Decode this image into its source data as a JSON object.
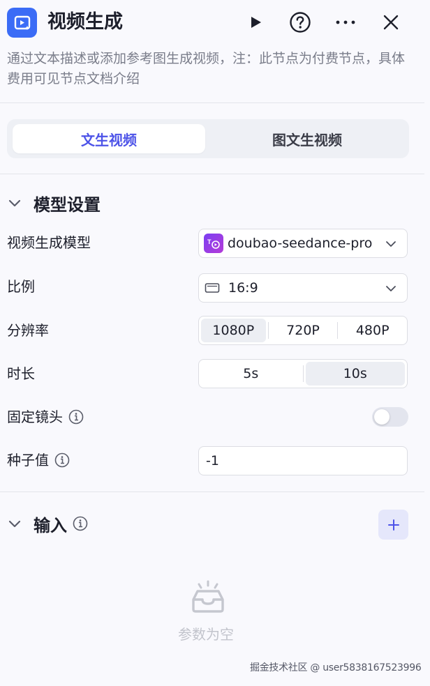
{
  "header": {
    "title": "视频生成",
    "run_icon": "play-icon",
    "help_icon": "question-circle-icon",
    "more_icon": "more-horizontal-icon",
    "close_icon": "close-icon"
  },
  "description": "通过文本描述或添加参考图生成视频，注：此节点为付费节点，具体费用可见节点文档介绍",
  "tabs": [
    {
      "label": "文生视频",
      "active": true
    },
    {
      "label": "图文生视频",
      "active": false
    }
  ],
  "model_section": {
    "title": "模型设置",
    "fields": {
      "model": {
        "label": "视频生成模型",
        "value": "doubao-seedance-pro"
      },
      "ratio": {
        "label": "比例",
        "value": "16:9"
      },
      "resolution": {
        "label": "分辨率",
        "options": [
          "1080P",
          "720P",
          "480P"
        ],
        "selected": "1080P"
      },
      "duration": {
        "label": "时长",
        "options": [
          "5s",
          "10s"
        ],
        "selected": "10s"
      },
      "fixed_camera": {
        "label": "固定镜头",
        "enabled": false
      },
      "seed": {
        "label": "种子值",
        "value": "-1"
      }
    }
  },
  "input_section": {
    "title": "输入",
    "empty_text": "参数为空"
  },
  "watermark": "掘金技术社区 @ user5838167523996",
  "colors": {
    "accent": "#4d53e8",
    "app_icon_bg": "#3b6cf6",
    "background": "#f9f9fd"
  }
}
